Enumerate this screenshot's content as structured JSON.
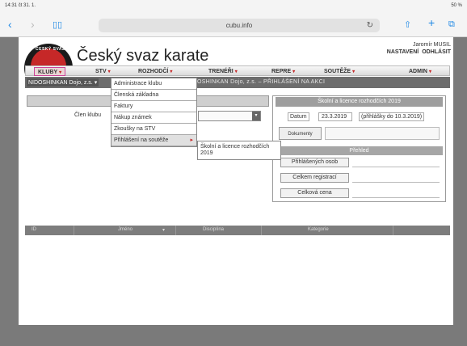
{
  "status": {
    "time": "14:31",
    "date": "čt 31. 1.",
    "battery": "50 %"
  },
  "browser": {
    "url": "cubu.info",
    "reload_glyph": "↻"
  },
  "site": {
    "title": "Český svaz karate",
    "user_name": "Jaromír MUSIL",
    "settings_link": "NASTAVENÍ",
    "logout_link": "ODHLÁSIT",
    "logo_text": "ČESKÝ SVAZ"
  },
  "menu": {
    "items": [
      "KLUBY",
      "STV",
      "ROZHODČÍ",
      "TRENÉŘI",
      "REPRE",
      "SOUTĚŽE",
      "ADMIN"
    ],
    "arrow": "▾"
  },
  "club": {
    "selected": "NIDOSHINKAN Dojo, z.s.",
    "arrow": "▾",
    "header": "NIDOSHINKAN Dojo, z.s. – PŘIHLÁŠENÍ NA AKCI"
  },
  "dropdown": {
    "items": [
      "Administrace klubu",
      "Členská základna",
      "Faktury",
      "Nákup známek",
      "Zkoušky na STV",
      "Přihlášení na soutěže"
    ],
    "submenu_arrow": "▸",
    "submenu": "Školní a licence rozhodčích 2019"
  },
  "form": {
    "member_label": "Člen klubu"
  },
  "right_panel": {
    "title": "Školní a licence rozhodčích 2019",
    "datum_label": "Datum",
    "date": "23.3.2019",
    "note": "(přihlášky do 10.3.2019)",
    "docs_button": "Dokumenty",
    "summary_title": "Přehled",
    "count_label": "Přihlášených osob",
    "reg_label": "Celkem registrací",
    "price_label": "Celková cena"
  },
  "table": {
    "columns": [
      "ID",
      "Jméno",
      "Disciplína",
      "Kategorie"
    ]
  },
  "colors": {
    "accent": "#c62828",
    "menubar": "#dadada",
    "subbar": "#6d6d6d"
  }
}
